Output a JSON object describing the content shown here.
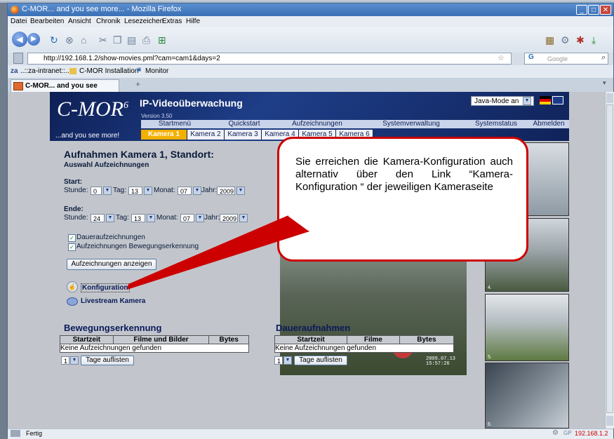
{
  "window": {
    "title": "C-MOR... and you see more... - Mozilla Firefox",
    "menu": [
      "Datei",
      "Bearbeiten",
      "Ansicht",
      "Chronik",
      "Lesezeichen",
      "Extras",
      "Hilfe"
    ],
    "url": "http://192.168.1.2/show-movies.pml?cam=cam1&days=2",
    "search_placeholder": "Google",
    "bookmarks": [
      "..::za-intranet::..",
      "C-MOR Installation",
      "Monitor"
    ],
    "tab_title": "C-MOR... and you see more...",
    "status": "Fertig",
    "status_ip": "192.168.1.2"
  },
  "site": {
    "logo": "C-MOR",
    "logo_sup": "6",
    "version": "Version 3.50",
    "subtitle": "IP-Videoüberwachung",
    "slogan": "...and you see more!",
    "java_mode": "Java-Mode an",
    "menu": [
      "Startmenü",
      "Quickstart",
      "Aufzeichnungen",
      "Systemverwaltung",
      "Systemstatus",
      "Abmelden"
    ],
    "cams": [
      "Kamera 1",
      "Kamera 2",
      "Kamera 3",
      "Kamera 4",
      "Kamera 5",
      "Kamera 6"
    ]
  },
  "page": {
    "heading": "Aufnahmen Kamera 1, Standort:",
    "subheading": "Auswahl Aufzeichnungen",
    "start_label": "Start:",
    "end_label": "Ende:",
    "stunde": "Stunde:",
    "tag": "Tag:",
    "monat": "Monat:",
    "jahr": "Jahr:",
    "start": {
      "stunde": "0",
      "tag": "13",
      "monat": "07",
      "jahr": "2009"
    },
    "end": {
      "stunde": "24",
      "tag": "13",
      "monat": "07",
      "jahr": "2009"
    },
    "chk1": "Daueraufzeichnungen",
    "chk2": "Aufzeichnungen Bewegungserkennung",
    "show_btn": "Aufzeichnungen anzeigen",
    "konfig_link": "Konfiguration",
    "livestream_link": "Livestream Kamera",
    "cam_stamp_date": "2009.07.13",
    "cam_stamp_time": "15:57:26"
  },
  "motion": {
    "title": "Bewegungserkennung",
    "cols": [
      "Startzeit",
      "Filme und Bilder",
      "Bytes"
    ],
    "empty": "Keine Aufzeichnungen gefunden",
    "days": "1",
    "btn": "Tage auflisten"
  },
  "continuous": {
    "title": "Daueraufnahmen",
    "cols": [
      "Startzeit",
      "Filme",
      "Bytes"
    ],
    "empty": "Keine Aufzeichnungen gefunden",
    "days": "1",
    "btn": "Tage auflisten"
  },
  "sidecams": [
    "4.",
    "5.",
    "6."
  ],
  "callout": "Sie erreichen die Kamera-Konfiguration auch alternativ über den Link “Kamera-Konfiguration “ der jeweiligen Kameraseite",
  "colors": {
    "accent": "#f3b000",
    "callout_border": "#cc0000",
    "header_bg": "#1e3e88"
  }
}
